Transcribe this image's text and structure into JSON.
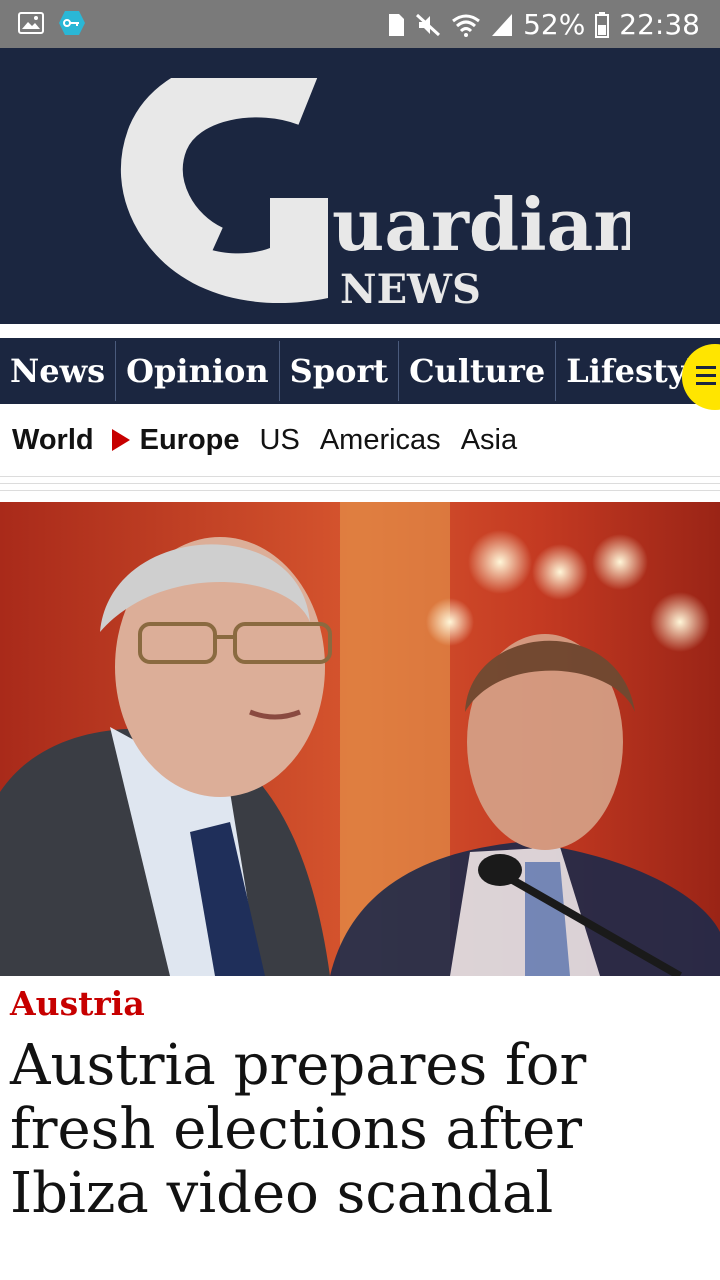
{
  "status_bar": {
    "battery": "52%",
    "time": "22:38",
    "icons": [
      "image-icon",
      "vpn-key-icon",
      "sim-icon",
      "mute-icon",
      "wifi-icon",
      "signal-icon",
      "battery-icon"
    ]
  },
  "masthead": {
    "logo_word": "uardian",
    "logo_sub": "NEWS"
  },
  "nav": {
    "pillars": [
      "News",
      "Opinion",
      "Sport",
      "Culture",
      "Lifestyle"
    ],
    "menu_icon": "menu-icon",
    "menu_color": "#ffe500"
  },
  "subnav": {
    "items": [
      "World",
      "Europe",
      "US",
      "Americas",
      "Asia"
    ]
  },
  "article": {
    "kicker": "Austria",
    "headline": "Austria prepares for fresh elections after Ibiza video scandal",
    "image_alt": "photo-of-two-men-at-press-conference"
  },
  "colors": {
    "brand_navy": "#1b2640",
    "accent_red": "#c70000",
    "menu_yellow": "#ffe500"
  }
}
